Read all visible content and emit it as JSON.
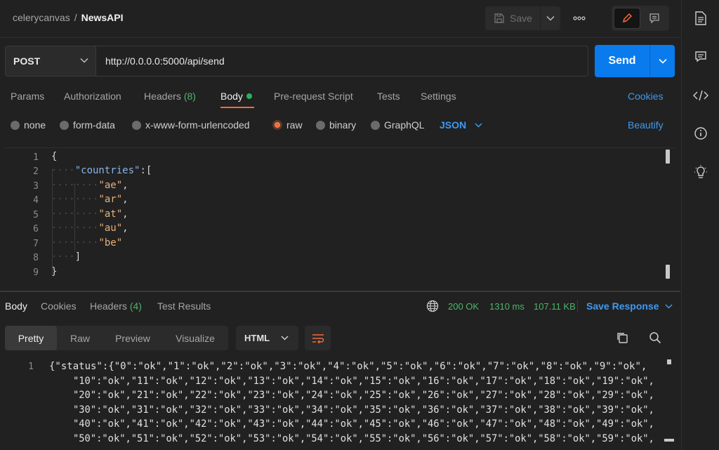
{
  "header": {
    "workspace": "celerycanvas",
    "separator": "/",
    "request_name": "NewsAPI",
    "save_label": "Save",
    "more_label": "ooo"
  },
  "request": {
    "method": "POST",
    "url": "http://0.0.0.0:5000/api/send",
    "send_label": "Send"
  },
  "request_tabs": {
    "params": "Params",
    "authorization": "Authorization",
    "headers": "Headers",
    "headers_count": "(8)",
    "body": "Body",
    "prerequest": "Pre-request Script",
    "tests": "Tests",
    "settings": "Settings",
    "cookies": "Cookies"
  },
  "body_types": {
    "none": "none",
    "form_data": "form-data",
    "urlencoded": "x-www-form-urlencoded",
    "raw": "raw",
    "binary": "binary",
    "graphql": "GraphQL",
    "language": "JSON",
    "beautify": "Beautify"
  },
  "editor": {
    "line_numbers": [
      "1",
      "2",
      "3",
      "4",
      "5",
      "6",
      "7",
      "8",
      "9"
    ],
    "l1": "{",
    "l2_key": "\"countries\"",
    "l2_rest": ":[",
    "l3": "\"ae\"",
    "l4": "\"ar\"",
    "l5": "\"at\"",
    "l6": "\"au\"",
    "l7": "\"be\"",
    "l8": "]",
    "l9": "}",
    "comma": ","
  },
  "response_tabs": {
    "body": "Body",
    "cookies": "Cookies",
    "headers": "Headers",
    "headers_count": "(4)",
    "test_results": "Test Results"
  },
  "response_status": {
    "code": "200 OK",
    "time": "1310 ms",
    "size": "107.11 KB",
    "save_response": "Save Response"
  },
  "response_format": {
    "pretty": "Pretty",
    "raw": "Raw",
    "preview": "Preview",
    "visualize": "Visualize",
    "language": "HTML"
  },
  "response_body": {
    "line_number": "1",
    "lines": [
      "{\"status\":{\"0\":\"ok\",\"1\":\"ok\",\"2\":\"ok\",\"3\":\"ok\",\"4\":\"ok\",\"5\":\"ok\",\"6\":\"ok\",\"7\":\"ok\",\"8\":\"ok\",\"9\":\"ok\",",
      "\"10\":\"ok\",\"11\":\"ok\",\"12\":\"ok\",\"13\":\"ok\",\"14\":\"ok\",\"15\":\"ok\",\"16\":\"ok\",\"17\":\"ok\",\"18\":\"ok\",\"19\":\"ok\",",
      "\"20\":\"ok\",\"21\":\"ok\",\"22\":\"ok\",\"23\":\"ok\",\"24\":\"ok\",\"25\":\"ok\",\"26\":\"ok\",\"27\":\"ok\",\"28\":\"ok\",\"29\":\"ok\",",
      "\"30\":\"ok\",\"31\":\"ok\",\"32\":\"ok\",\"33\":\"ok\",\"34\":\"ok\",\"35\":\"ok\",\"36\":\"ok\",\"37\":\"ok\",\"38\":\"ok\",\"39\":\"ok\",",
      "\"40\":\"ok\",\"41\":\"ok\",\"42\":\"ok\",\"43\":\"ok\",\"44\":\"ok\",\"45\":\"ok\",\"46\":\"ok\",\"47\":\"ok\",\"48\":\"ok\",\"49\":\"ok\",",
      "\"50\":\"ok\",\"51\":\"ok\",\"52\":\"ok\",\"53\":\"ok\",\"54\":\"ok\",\"55\":\"ok\",\"56\":\"ok\",\"57\":\"ok\",\"58\":\"ok\",\"59\":\"ok\","
    ]
  },
  "colors": {
    "accent_orange": "#f26b3a",
    "send_blue": "#097bed",
    "link_blue": "#3d9bf2",
    "status_green": "#4fb56a"
  },
  "icons": {
    "save": "save-icon",
    "edit": "pencil-icon",
    "comment": "comment-icon",
    "docs": "document-icon",
    "comments": "comments-icon",
    "code": "code-icon",
    "info": "info-icon",
    "lightbulb": "lightbulb-icon",
    "globe": "globe-icon",
    "wrap": "wrap-lines-icon",
    "copy": "copy-icon",
    "search": "search-icon"
  }
}
